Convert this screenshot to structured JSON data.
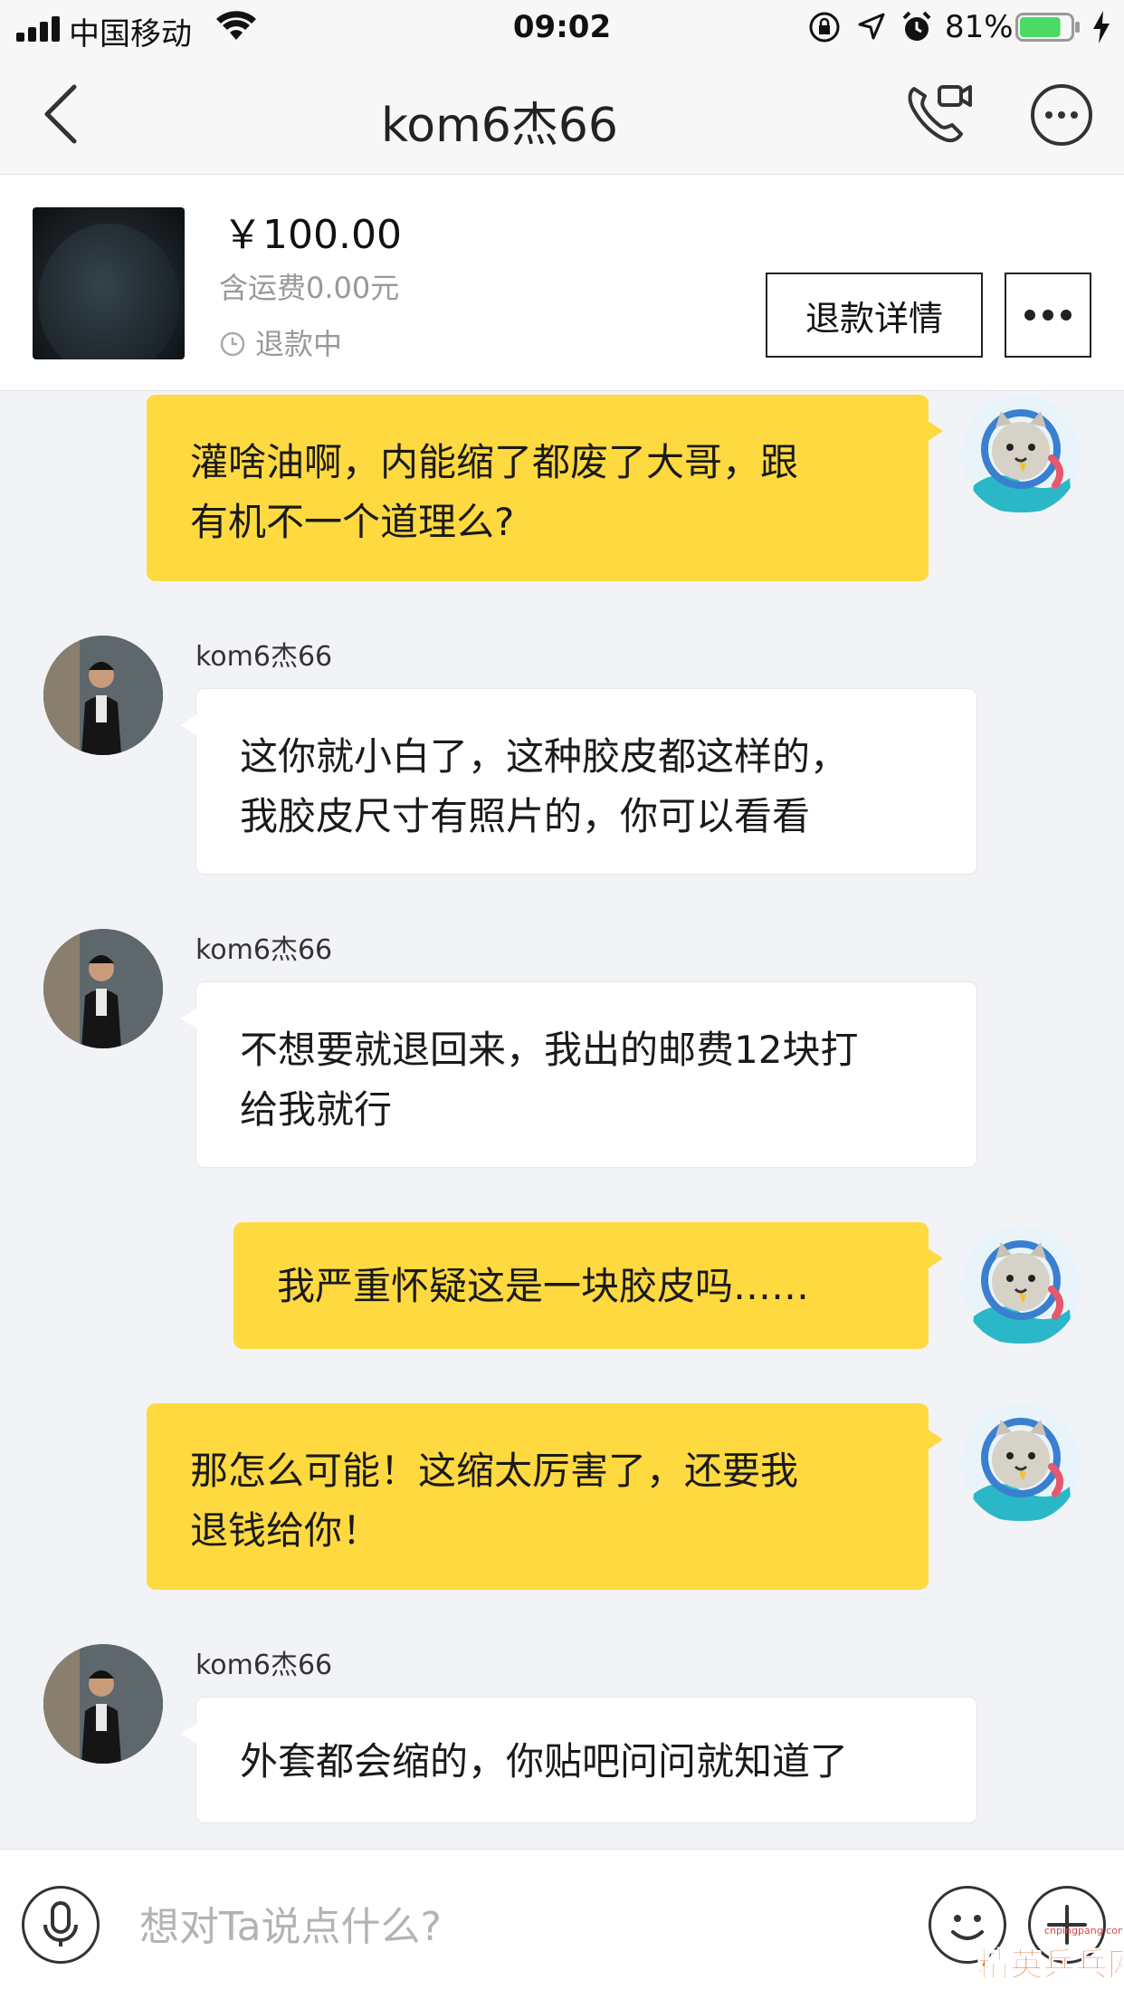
{
  "status_bar": {
    "carrier": "中国移动",
    "time": "09:02",
    "battery_percent": "81%",
    "battery_color": "#4cd964"
  },
  "nav": {
    "title": "kom6杰66",
    "back_icon": "chevron-left-icon",
    "call_icon": "phone-video-icon",
    "more_icon": "more-dots-icon"
  },
  "product": {
    "price": "￥100.00",
    "shipping": "含运费0.00元",
    "status": "退款中",
    "refund_detail_label": "退款详情"
  },
  "messages": [
    {
      "from": "me",
      "text_lines": [
        "灌啥油啊，内能缩了都废了大哥，跟",
        "有机不一个道理么?"
      ]
    },
    {
      "from": "them",
      "sender": "kom6杰66",
      "text_lines": [
        "这你就小白了，这种胶皮都这样的，",
        "我胶皮尺寸有照片的，你可以看看"
      ]
    },
    {
      "from": "them",
      "sender": "kom6杰66",
      "text_lines": [
        "不想要就退回来，我出的邮费12块打",
        "给我就行"
      ]
    },
    {
      "from": "me",
      "text_lines": [
        "我严重怀疑这是一块胶皮吗……"
      ]
    },
    {
      "from": "me",
      "text_lines": [
        "那怎么可能！这缩太厉害了，还要我",
        "退钱给你！"
      ]
    },
    {
      "from": "them",
      "sender": "kom6杰66",
      "text_lines": [
        "外套都会缩的，你贴吧问问就知道了"
      ]
    }
  ],
  "input": {
    "placeholder": "想对Ta说点什么?",
    "value": ""
  },
  "watermark": {
    "main": "精英乒乓网",
    "url": "cnpingpang.com"
  },
  "colors": {
    "my_bubble": "#ffd940",
    "their_bubble": "#ffffff",
    "background": "#f2f3f6"
  }
}
